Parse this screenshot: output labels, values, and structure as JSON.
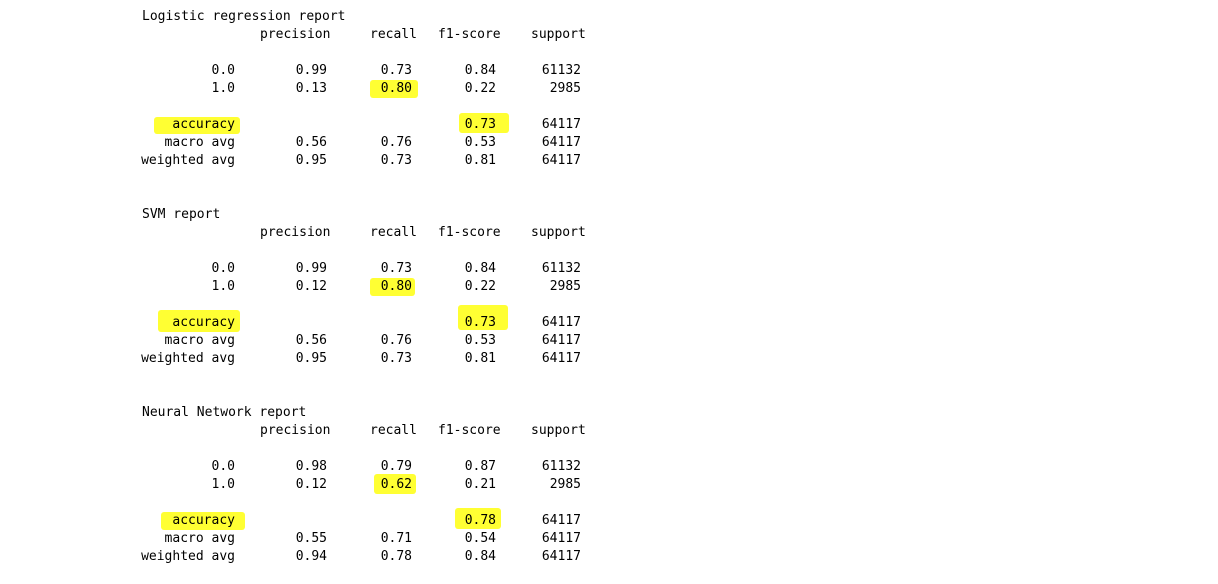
{
  "header": {
    "precision": "precision",
    "recall": "recall",
    "f1": "f1-score",
    "support": "support"
  },
  "reports": [
    {
      "title": "Logistic regression report",
      "class0": {
        "label": "0.0",
        "precision": "0.99",
        "recall": "0.73",
        "f1": "0.84",
        "support": "61132"
      },
      "class1": {
        "label": "1.0",
        "precision": "0.13",
        "recall": "0.80",
        "f1": "0.22",
        "support": "2985"
      },
      "accuracy": {
        "label": "accuracy",
        "f1": "0.73",
        "support": "64117"
      },
      "macro": {
        "label": "macro avg",
        "precision": "0.56",
        "recall": "0.76",
        "f1": "0.53",
        "support": "64117"
      },
      "weighted": {
        "label": "weighted avg",
        "precision": "0.95",
        "recall": "0.73",
        "f1": "0.81",
        "support": "64117"
      }
    },
    {
      "title": "SVM report",
      "class0": {
        "label": "0.0",
        "precision": "0.99",
        "recall": "0.73",
        "f1": "0.84",
        "support": "61132"
      },
      "class1": {
        "label": "1.0",
        "precision": "0.12",
        "recall": "0.80",
        "f1": "0.22",
        "support": "2985"
      },
      "accuracy": {
        "label": "accuracy",
        "f1": "0.73",
        "support": "64117"
      },
      "macro": {
        "label": "macro avg",
        "precision": "0.56",
        "recall": "0.76",
        "f1": "0.53",
        "support": "64117"
      },
      "weighted": {
        "label": "weighted avg",
        "precision": "0.95",
        "recall": "0.73",
        "f1": "0.81",
        "support": "64117"
      }
    },
    {
      "title": "Neural Network report",
      "class0": {
        "label": "0.0",
        "precision": "0.98",
        "recall": "0.79",
        "f1": "0.87",
        "support": "61132"
      },
      "class1": {
        "label": "1.0",
        "precision": "0.12",
        "recall": "0.62",
        "f1": "0.21",
        "support": "2985"
      },
      "accuracy": {
        "label": "accuracy",
        "f1": "0.78",
        "support": "64117"
      },
      "macro": {
        "label": "macro avg",
        "precision": "0.55",
        "recall": "0.71",
        "f1": "0.54",
        "support": "64117"
      },
      "weighted": {
        "label": "weighted avg",
        "precision": "0.94",
        "recall": "0.78",
        "f1": "0.84",
        "support": "64117"
      }
    }
  ],
  "highlight_color": "#ffff33"
}
